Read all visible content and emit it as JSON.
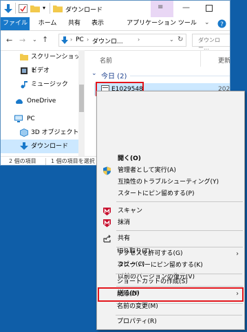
{
  "window": {
    "title": "ダウンロード",
    "tabs": [
      "ファイル",
      "ホーム",
      "共有",
      "表示",
      "アプリケーション ツール"
    ],
    "address_path": [
      "PC",
      "ダウンロ..."
    ],
    "search_placeholder": "ダウンロー...",
    "content_headers": {
      "name": "名前",
      "modified": "更新"
    },
    "group_label": "今日 (2)",
    "selected_file": {
      "name": "E1029548",
      "date": "202"
    },
    "nav_items": [
      "スクリーンショット",
      "ビデオ",
      "ミュージック",
      "OneDrive",
      "PC",
      "3D オブジェクト",
      "ダウンロード"
    ],
    "status": {
      "count": "2 個の項目",
      "selected": "1 個の項目を選択"
    }
  },
  "context_menu": {
    "items": [
      "開く(O)",
      "管理者として実行(A)",
      "互換性のトラブルシューティング(Y)",
      "スタートにピン留めする(P)",
      "スキャン",
      "抹消",
      "共有",
      "アクセスを許可する(G)",
      "タスク バーにピン留めする(K)",
      "以前のバージョンの復元(V)",
      "送る(N)",
      "切り取り(T)",
      "コピー(C)",
      "ショートカットの作成(S)",
      "削除(D)",
      "名前の変更(M)",
      "プロパティ(R)"
    ]
  },
  "colors": {
    "accent": "#1979ca",
    "highlight": "#e3151b",
    "desktop": "#0f5ea8",
    "selection": "#cce8ff",
    "mcafee": "#c8102e"
  },
  "icons": [
    "folder-icon",
    "video-icon",
    "music-icon",
    "cloud-icon",
    "pc-icon",
    "cube-icon",
    "download-icon",
    "shield-icon",
    "mcafee-icon",
    "share-icon"
  ]
}
